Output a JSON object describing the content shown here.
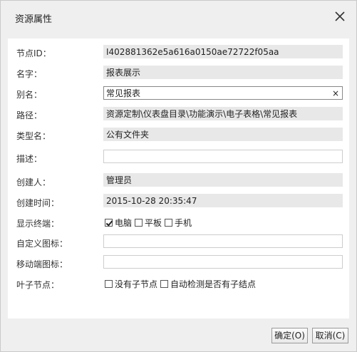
{
  "dialog": {
    "title": "资源属性",
    "close_icon": "close-icon"
  },
  "fields": {
    "node_id": {
      "label": "节点ID：",
      "value": "I402881362e5a616a0150ae72722f05aa"
    },
    "name": {
      "label": "名字：",
      "value": "报表展示"
    },
    "alias": {
      "label": "别名：",
      "value": "常见报表",
      "clear": "×"
    },
    "path": {
      "label": "路径：",
      "value": "资源定制\\仪表盘目录\\功能演示\\电子表格\\常见报表"
    },
    "type_name": {
      "label": "类型名：",
      "value": "公有文件夹"
    },
    "description": {
      "label": "描述：",
      "value": ""
    },
    "creator": {
      "label": "创建人：",
      "value": "管理员"
    },
    "created_time": {
      "label": "创建时间：",
      "value": "2015-10-28 20:35:47"
    },
    "display_terminal": {
      "label": "显示终端：",
      "options": [
        {
          "label": "电脑",
          "checked": true
        },
        {
          "label": "平板",
          "checked": false
        },
        {
          "label": "手机",
          "checked": false
        }
      ]
    },
    "custom_icon": {
      "label": "自定义图标：",
      "value": ""
    },
    "mobile_icon": {
      "label": "移动端图标：",
      "value": ""
    },
    "leaf_node": {
      "label": "叶子节点：",
      "options": [
        {
          "label": "没有子节点",
          "checked": false
        },
        {
          "label": "自动检测是否有子结点",
          "checked": false
        }
      ]
    }
  },
  "buttons": {
    "ok": "确定(O)",
    "cancel": "取消(C)"
  }
}
